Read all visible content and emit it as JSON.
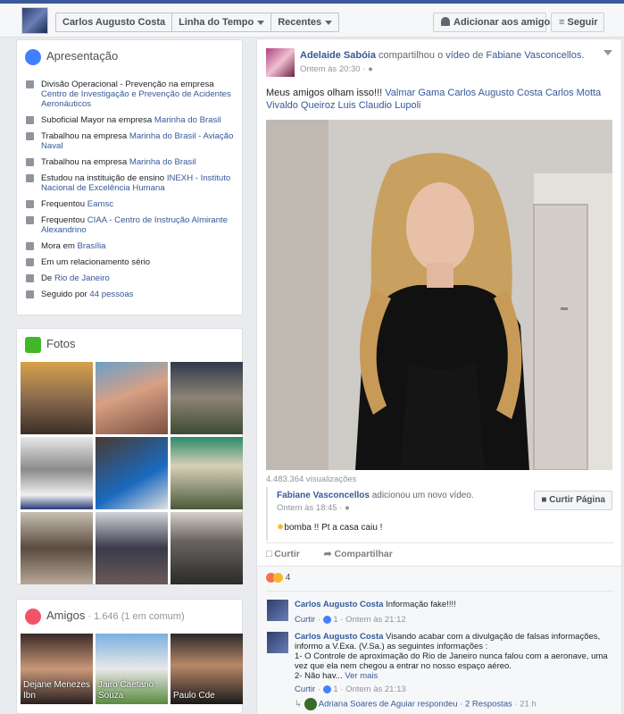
{
  "header": {
    "profile_name": "Carlos Augusto Costa",
    "tab_timeline": "Linha do Tempo",
    "tab_recent": "Recentes",
    "add_friend": "Adicionar aos amigos",
    "follow": "Seguir"
  },
  "intro": {
    "title": "Apresentação",
    "items": [
      {
        "text": "Divisão Operacional - Prevenção na empresa ",
        "link": "Centro de Investigação e Prevenção de Acidentes Aeronáuticos"
      },
      {
        "text": "Suboficial Mayor na empresa ",
        "link": "Marinha do Brasil"
      },
      {
        "text": "Trabalhou na empresa ",
        "link": "Marinha do Brasil - Aviação Naval"
      },
      {
        "text": "Trabalhou na empresa ",
        "link": "Marinha do Brasil"
      },
      {
        "text": "Estudou na instituição de ensino ",
        "link": "INEXH - Instituto Nacional de Excelência Humana"
      },
      {
        "text": "Frequentou ",
        "link": "Eamsc"
      },
      {
        "text": "Frequentou ",
        "link": "CIAA - Centro de Instrução Almirante Alexandrino"
      },
      {
        "text": "Mora em ",
        "link": "Brasília"
      },
      {
        "text": "Em um relacionamento sério",
        "link": ""
      },
      {
        "text": "De ",
        "link": "Rio de Janeiro"
      },
      {
        "text": "Seguido por ",
        "link": "44 pessoas"
      }
    ]
  },
  "photos": {
    "title": "Fotos"
  },
  "friends": {
    "title": "Amigos",
    "count": "· 1.646 (1 em comum)",
    "items": [
      {
        "name": "Dejane Menezes Ibn"
      },
      {
        "name": "Jairo Caetano Souza"
      },
      {
        "name": "Paulo Cde"
      }
    ]
  },
  "post": {
    "author": "Adelaide Sabóia",
    "shared_text": " compartilhou o ",
    "video_word": "vídeo",
    "of_text": " de ",
    "original_author": "Fabiane Vasconcellos",
    "time": "Ontem às 20:30",
    "message": "Meus amigos olham isso!!! ",
    "tags": "Valmar Gama Carlos Augusto Costa Carlos Motta Vivaldo Queiroz Luis Claudio Lupoli",
    "views": "4.483.364 visualizações",
    "shared_author": "Fabiane Vasconcellos",
    "shared_action": " adicionou um novo vídeo.",
    "shared_time": "Ontem às 18:45",
    "like_page": "Curtir Página",
    "shared_message": "bomba !! Pt a casa caiu !",
    "like": "Curtir",
    "share": "Compartilhar",
    "reactions_count": "4"
  },
  "comments": [
    {
      "author": "Carlos Augusto Costa",
      "text": " Informação fake!!!!",
      "like": "Curtir",
      "count": "1",
      "time": "Ontem às 21:12"
    },
    {
      "author": "Carlos Augusto Costa",
      "text": " Visando acabar com a divulgação de falsas informações, informo a V.Exa. (V.Sa.) as seguintes informações :",
      "line2": "1- O Controle de aproximação do Rio de Janeiro nunca falou com a aeronave, uma vez que ela nem chegou a entrar no nosso espaço aéreo.",
      "line3": "2- Não hav... ",
      "more": "Ver mais",
      "like": "Curtir",
      "count": "1",
      "time": "Ontem às 21:13"
    }
  ],
  "reply": {
    "author": "Adriana Soares de Aguiar",
    "text": " respondeu · ",
    "count": "2 Respostas",
    "time": "· 21 h"
  }
}
